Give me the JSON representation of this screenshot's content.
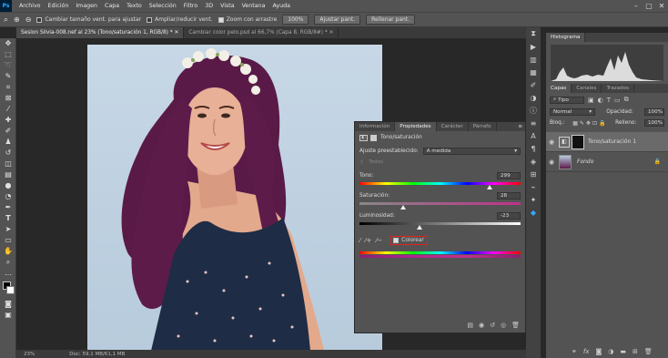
{
  "menu": {
    "logo": "Ps",
    "items": [
      "Archivo",
      "Edición",
      "Imagen",
      "Capa",
      "Texto",
      "Selección",
      "Filtro",
      "3D",
      "Vista",
      "Ventana",
      "Ayuda"
    ]
  },
  "window": {
    "min": "–",
    "max": "▢",
    "close": "✕"
  },
  "options": {
    "cambiar": "Cambiar tamaño vent. para ajustar",
    "ampliar": "Ampliar/reducir vent.",
    "zoom_arrastre": "Zoom con arrastre",
    "zoom_value": "100%",
    "ajustar": "Ajustar pant.",
    "rellenar": "Rellenar pant."
  },
  "tabs": [
    {
      "label": "Sesion Silvia-008.nef al 23% (Tono/saturación 1, RGB/8) *",
      "close": "✕"
    },
    {
      "label": "Cambiar color pelo.psd al 66,7% (Capa 8, RGB/8#) *",
      "close": "✕"
    }
  ],
  "status": {
    "zoom": "23%",
    "doc": "Doc: 59,1 MB/61,1 MB"
  },
  "properties": {
    "tabs": [
      "Información",
      "Propiedades",
      "Carácter",
      "Párrafo"
    ],
    "title": "Tono/saturación",
    "preset_label": "Ajuste preestablecido:",
    "preset_value": "A medida",
    "channel": "Todos",
    "hue_label": "Tono:",
    "hue_value": "299",
    "hue": 299,
    "sat_label": "Saturación:",
    "sat_value": "28",
    "sat": 28,
    "lum_label": "Luminosidad:",
    "lum_value": "-23",
    "lum": -23,
    "colorize_label": "Colorear"
  },
  "histogram": {
    "tab": "Histograma"
  },
  "layers": {
    "tabs": [
      "Capas",
      "Canales",
      "Trazados"
    ],
    "kind": "Tipo",
    "blend": "Normal",
    "opacity_label": "Opacidad:",
    "opacity": "100%",
    "lock_label": "Bloq.:",
    "fill_label": "Relleno:",
    "fill": "100%",
    "items": [
      {
        "name": "Tono/saturación 1"
      },
      {
        "name": "Fondo"
      }
    ]
  },
  "colors": {
    "accent": "#31a8ff",
    "selection_red": "#e0231c",
    "hair": "#5a1a48",
    "dress": "#1f2c45"
  }
}
